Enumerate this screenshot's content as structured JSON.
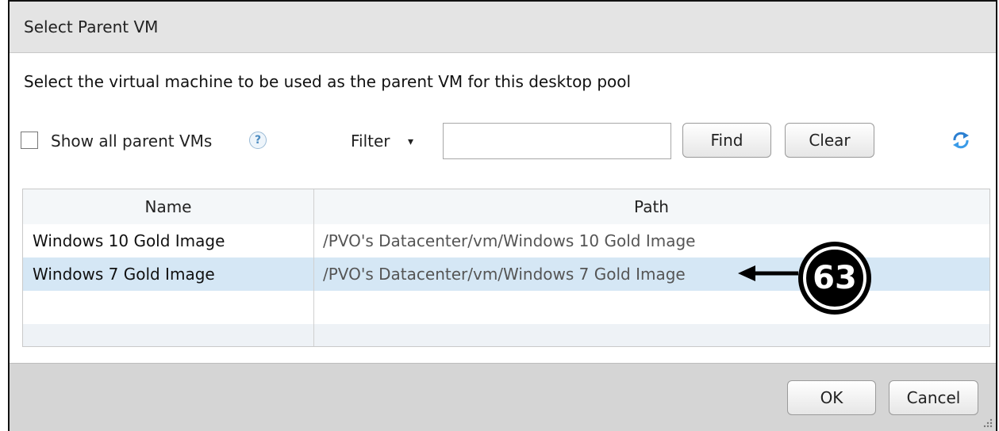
{
  "dialog": {
    "title": "Select Parent VM",
    "instructions": "Select the virtual machine to be used as the parent VM for this desktop pool"
  },
  "toolbar": {
    "show_all_label": "Show all parent VMs",
    "show_all_checked": false,
    "help_glyph": "?",
    "filter_label": "Filter",
    "filter_caret": "▾",
    "filter_value": "",
    "filter_placeholder": "",
    "find_label": "Find",
    "clear_label": "Clear",
    "refresh_icon": "refresh-icon"
  },
  "table": {
    "columns": [
      "Name",
      "Path"
    ],
    "rows": [
      {
        "name": "Windows 10 Gold Image",
        "path": "/PVO's Datacenter/vm/Windows 10 Gold Image",
        "selected": false
      },
      {
        "name": "Windows 7 Gold Image",
        "path": "/PVO's Datacenter/vm/Windows 7 Gold Image",
        "selected": true
      }
    ]
  },
  "footer": {
    "ok_label": "OK",
    "cancel_label": "Cancel"
  },
  "annotation": {
    "callout_number": "63"
  },
  "colors": {
    "selected_row": "#d5e7f5",
    "titlebar": "#e4e4e4",
    "footer": "#d5d5d5"
  }
}
